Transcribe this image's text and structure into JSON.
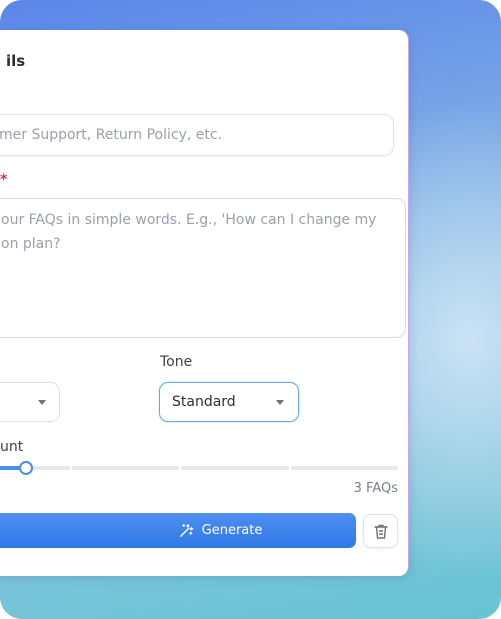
{
  "card": {
    "title": "ils",
    "topic": {
      "value": "",
      "placeholder": "mer Support, Return Policy, etc."
    },
    "description": {
      "required_marker": "*",
      "placeholder_lines": [
        "our FAQs in simple words. E.g., 'How can I change my",
        "on plan?"
      ]
    },
    "tone": {
      "label": "Tone",
      "selected": "Standard"
    },
    "count": {
      "label": "unt",
      "value_text": "3 FAQs",
      "slider_fraction": 0.15,
      "tick_fractions": [
        0.25,
        0.5,
        0.75
      ]
    },
    "actions": {
      "generate_label": "Generate",
      "generate_icon": "magic-wand-icon",
      "delete_icon": "trash-icon"
    }
  },
  "colors": {
    "accent": "#2f78e6",
    "required": "#e0314b"
  }
}
